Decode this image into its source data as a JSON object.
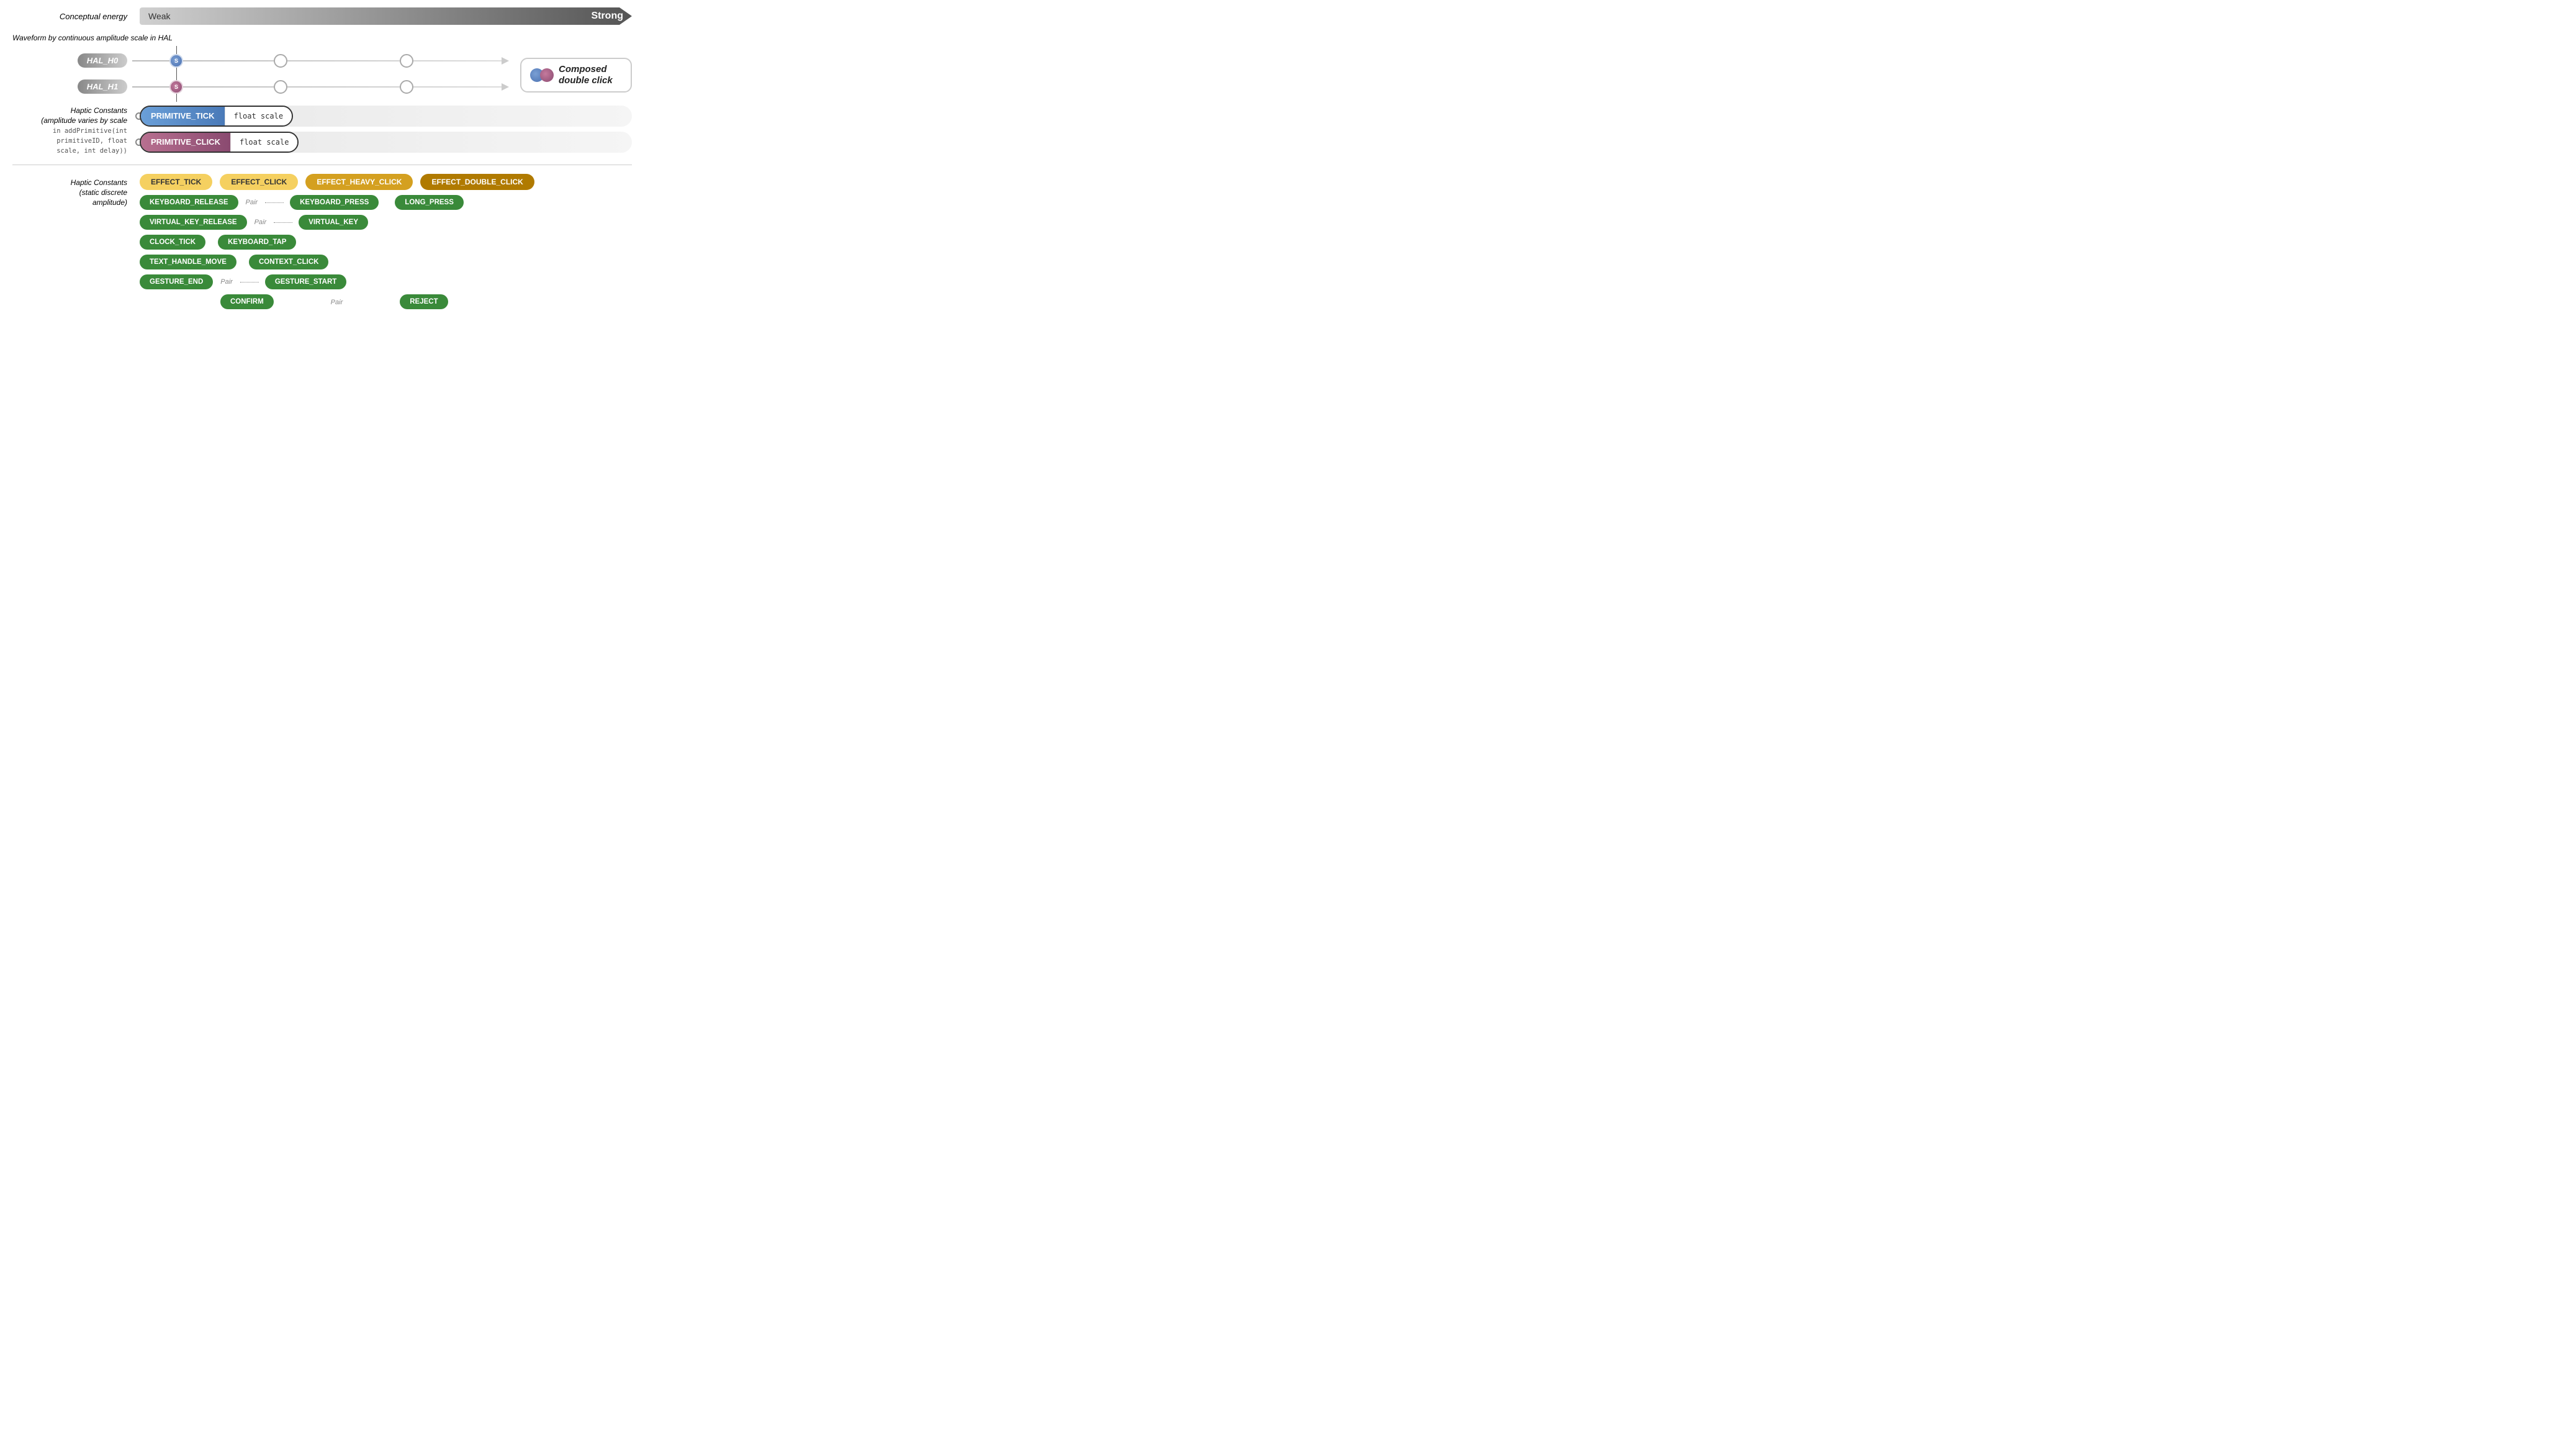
{
  "energy": {
    "label": "Conceptual energy",
    "weak": "Weak",
    "strong": "Strong"
  },
  "waveform": {
    "label": "Waveform by continuous\namplitude scale in HAL"
  },
  "hal": {
    "h0_label": "HAL_H0",
    "h1_label": "HAL_H1",
    "dot_s": "S"
  },
  "composed": {
    "text_line1": "Composed",
    "text_line2": "double click"
  },
  "primitives": {
    "label_line1": "Haptic Constants",
    "label_line2": "(amplitude varies by scale",
    "label_line3": "in addPrimitive(int",
    "label_line4": "primitiveID, float",
    "label_line5": "scale, int delay))",
    "tick_name": "PRIMITIVE_TICK",
    "click_name": "PRIMITIVE_CLICK",
    "scale_text": "float scale"
  },
  "haptic_bottom": {
    "label_line1": "Haptic Constants",
    "label_line2": "(static discrete",
    "label_line3": "amplitude)"
  },
  "effects": {
    "effect_tick": "EFFECT_TICK",
    "effect_click": "EFFECT_CLICK",
    "effect_heavy_click": "EFFECT_HEAVY_CLICK",
    "effect_double_click": "EFFECT_DOUBLE_CLICK"
  },
  "haptic_items": {
    "keyboard_release": "KEYBOARD_RELEASE",
    "keyboard_press": "KEYBOARD_PRESS",
    "long_press": "LONG_PRESS",
    "virtual_key_release": "VIRTUAL_KEY_RELEASE",
    "virtual_key": "VIRTUAL_KEY",
    "clock_tick": "CLOCK_TICK",
    "keyboard_tap": "KEYBOARD_TAP",
    "text_handle_move": "TEXT_HANDLE_MOVE",
    "context_click": "CONTEXT_CLICK",
    "gesture_end": "GESTURE_END",
    "gesture_start": "GESTURE_START",
    "confirm": "CONFIRM",
    "reject": "REJECT",
    "pair": "Pair"
  }
}
